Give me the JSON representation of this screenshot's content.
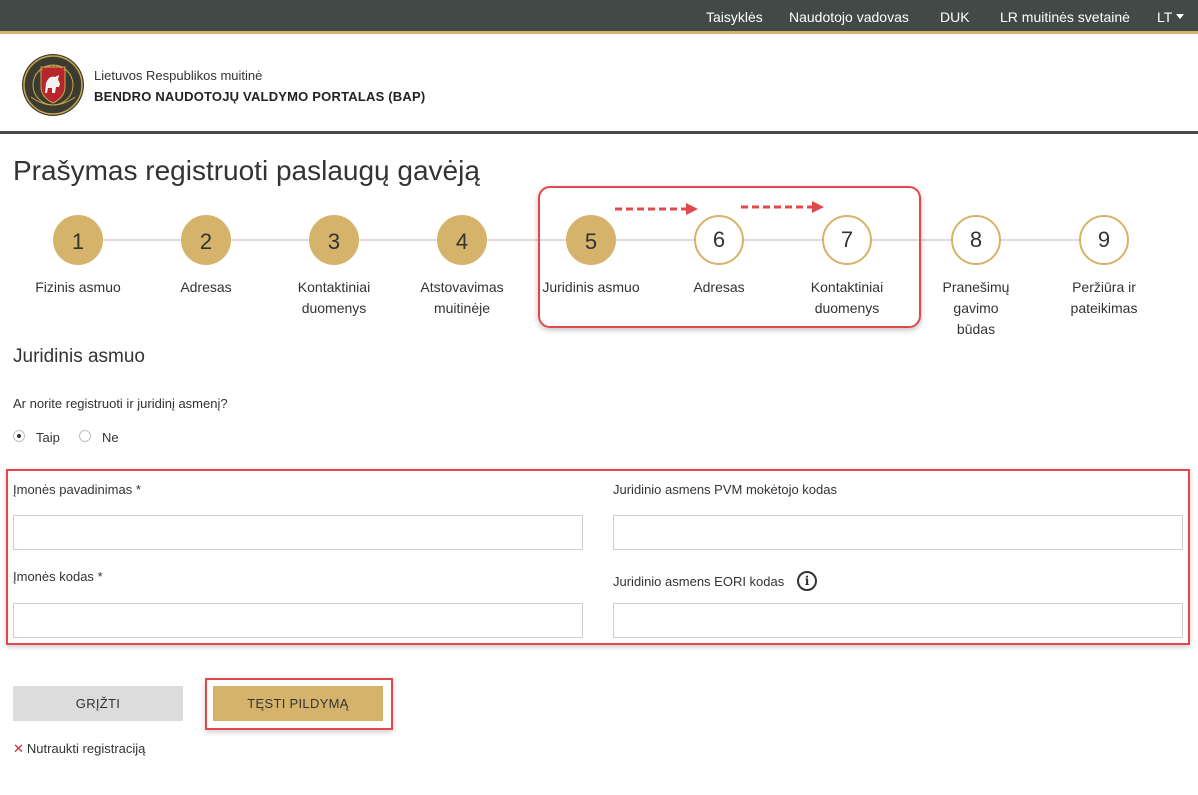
{
  "topnav": {
    "items": [
      "Taisyklės",
      "Naudotojo vadovas",
      "DUK",
      "LR muitinės svetainė"
    ],
    "language": "LT"
  },
  "header": {
    "org_name": "Lietuvos Respublikos muitinė",
    "portal_name": "BENDRO NAUDOTOJŲ VALDYMO PORTALAS (BAP)",
    "logo_icon": "lithuanian-customs-emblem-icon",
    "logo_text": "LIETUVOS MUITINĖ"
  },
  "page_title": "Prašymas registruoti paslaugų gavėją",
  "steps": [
    {
      "number": "1",
      "label": "Fizinis asmuo",
      "state": "done"
    },
    {
      "number": "2",
      "label": "Adresas",
      "state": "done"
    },
    {
      "number": "3",
      "label": "Kontaktiniai duomenys",
      "state": "done"
    },
    {
      "number": "4",
      "label": "Atstovavimas muitinėje",
      "state": "done"
    },
    {
      "number": "5",
      "label": "Juridinis asmuo",
      "state": "current"
    },
    {
      "number": "6",
      "label": "Adresas",
      "state": "todo"
    },
    {
      "number": "7",
      "label": "Kontaktiniai duomenys",
      "state": "todo"
    },
    {
      "number": "8",
      "label": "Pranešimų gavimo būdas",
      "state": "todo"
    },
    {
      "number": "9",
      "label": "Peržiūra ir pateikimas",
      "state": "todo"
    }
  ],
  "section_title": "Juridinis asmuo",
  "question": "Ar norite registruoti ir juridinį asmenį?",
  "radio": {
    "options": [
      "Taip",
      "Ne"
    ],
    "selected": "Taip"
  },
  "fields": {
    "company_name": {
      "label": "Įmonės pavadinimas",
      "required": "*",
      "value": ""
    },
    "vat_code": {
      "label": "Juridinio asmens PVM mokėtojo kodas",
      "value": ""
    },
    "company_code": {
      "label": "Įmonės kodas",
      "required": "*",
      "value": ""
    },
    "eori_code": {
      "label": "Juridinio asmens EORI kodas",
      "value": "",
      "info_icon": "info-icon"
    }
  },
  "buttons": {
    "back": "GRĮŽTI",
    "next": "TĘSTI PILDYMĄ"
  },
  "cancel_link": "Nutraukti registraciją",
  "colors": {
    "topbar": "#414a46",
    "accent_gold": "#d5b36a",
    "annotation_red": "#e2484b"
  }
}
